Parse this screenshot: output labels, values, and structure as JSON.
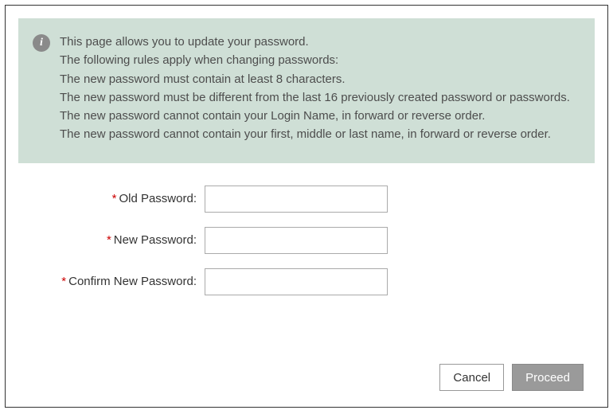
{
  "info": {
    "lines": [
      "This page allows you to update your password.",
      "The following rules apply when changing passwords:",
      "The new password must contain at least 8 characters.",
      "The new password must be different from the last 16 previously created password or passwords.",
      "The new password cannot contain your Login Name, in forward or reverse order.",
      "The new password cannot contain your first, middle or last name, in forward or reverse order."
    ],
    "icon_glyph": "i"
  },
  "form": {
    "required_marker": "*",
    "old_password_label": "Old Password:",
    "new_password_label": "New Password:",
    "confirm_password_label": "Confirm New Password:",
    "old_password_value": "",
    "new_password_value": "",
    "confirm_password_value": ""
  },
  "buttons": {
    "cancel": "Cancel",
    "proceed": "Proceed"
  }
}
